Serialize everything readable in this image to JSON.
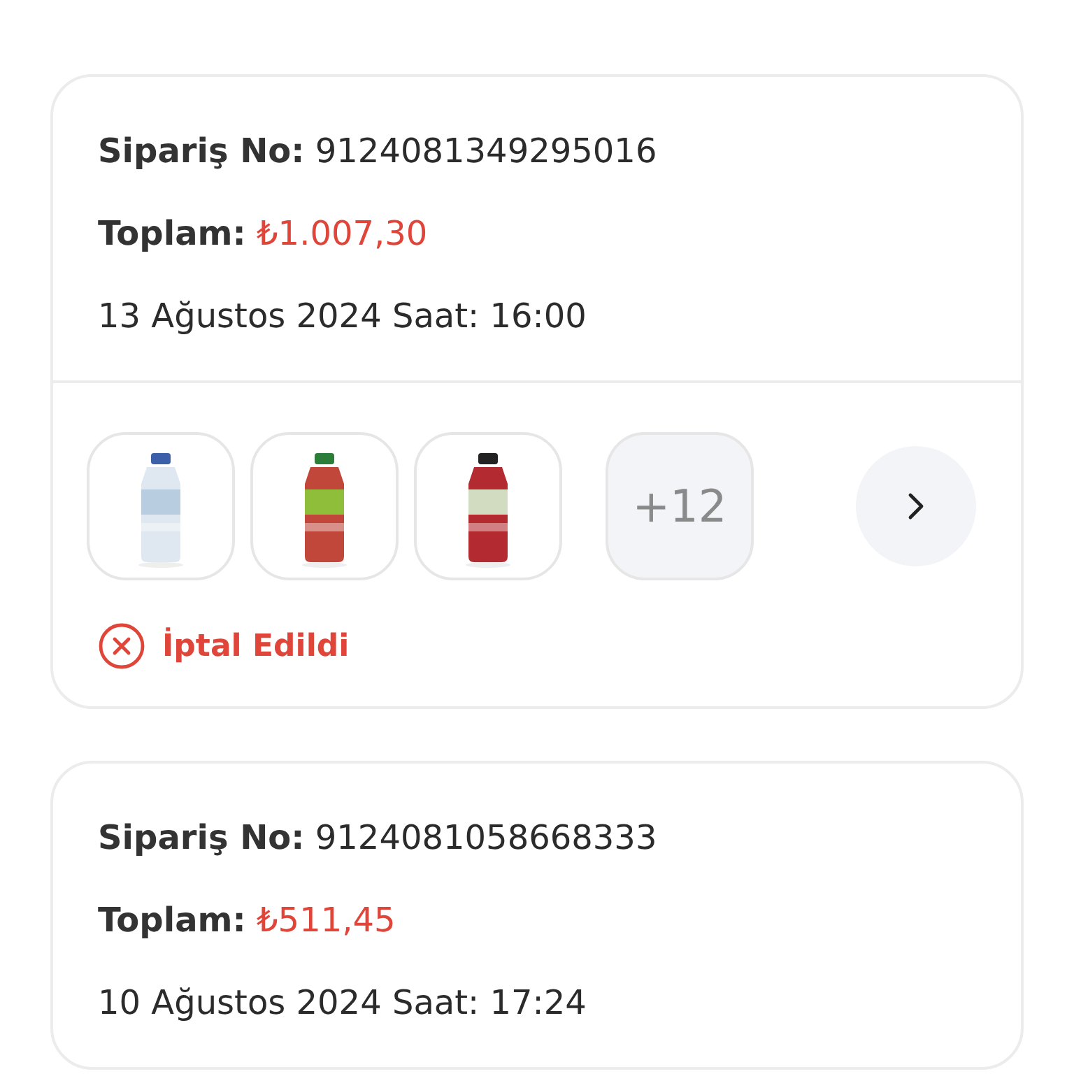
{
  "orders": [
    {
      "order_no_label": "Sipariş No:",
      "order_no": "9124081349295016",
      "total_label": "Toplam:",
      "total": "₺1.007,30",
      "date": "13 Ağustos 2024 Saat: 16:00",
      "more_count": "+12",
      "status": {
        "kind": "cancelled",
        "text": "İptal Edildi"
      }
    },
    {
      "order_no_label": "Sipariş No:",
      "order_no": "9124081058668333",
      "total_label": "Toplam:",
      "total": "₺511,45",
      "date": "10 Ağustos 2024 Saat: 17:24"
    }
  ]
}
